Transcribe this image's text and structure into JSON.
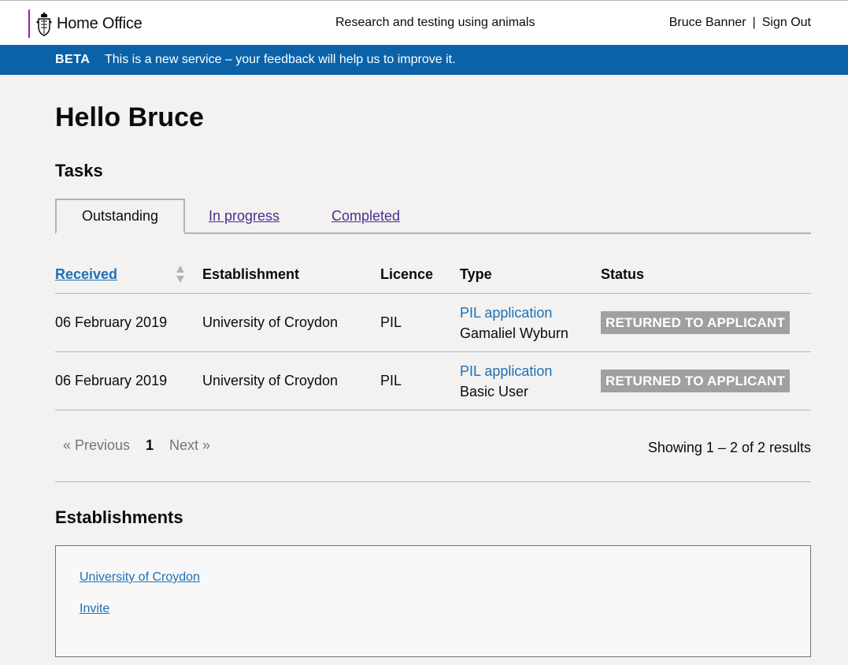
{
  "header": {
    "brand": "Home Office",
    "service": "Research and testing using animals",
    "user": "Bruce Banner",
    "separator": "|",
    "sign_out": "Sign Out"
  },
  "beta": {
    "tag": "BETA",
    "text_before": "This is a new service – your ",
    "link": "feedback",
    "text_after": " will help us to improve it."
  },
  "page": {
    "title": "Hello Bruce",
    "tasks_heading": "Tasks",
    "establishments_heading": "Establishments"
  },
  "tabs": [
    {
      "label": "Outstanding",
      "active": true
    },
    {
      "label": "In progress",
      "active": false
    },
    {
      "label": "Completed",
      "active": false
    }
  ],
  "table": {
    "headers": {
      "received": "Received",
      "establishment": "Establishment",
      "licence": "Licence",
      "type": "Type",
      "status": "Status"
    },
    "rows": [
      {
        "received": "06 February 2019",
        "establishment": "University of Croydon",
        "licence": "PIL",
        "type_link": "PIL application",
        "type_sub": "Gamaliel Wyburn",
        "status": "RETURNED TO APPLICANT"
      },
      {
        "received": "06 February 2019",
        "establishment": "University of Croydon",
        "licence": "PIL",
        "type_link": "PIL application",
        "type_sub": "Basic User",
        "status": "RETURNED TO APPLICANT"
      }
    ]
  },
  "pagination": {
    "previous": "« Previous",
    "current": "1",
    "next": "Next »",
    "results": "Showing 1 – 2 of 2 results"
  },
  "establishments": {
    "links": [
      "University of Croydon",
      "Invite"
    ]
  },
  "colors": {
    "beta_bg": "#0b62a8",
    "brand_accent": "#9325b2",
    "link": "#1d70b8",
    "visited_link": "#4c2c92",
    "badge_bg": "#a0a0a0",
    "page_bg": "#f3f2f1"
  },
  "icons": {
    "crest": "royal-crest-icon",
    "sort": "sort-arrows-icon"
  }
}
